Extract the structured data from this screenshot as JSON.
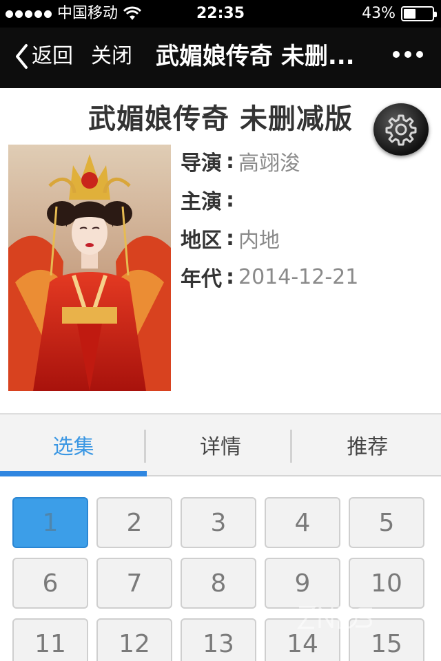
{
  "status_bar": {
    "carrier": "中国移动",
    "time": "22:35",
    "battery_percent": "43%",
    "battery_level": 0.43
  },
  "nav": {
    "back_label": "返回",
    "close_label": "关闭",
    "title": "武媚娘传奇 未删..."
  },
  "detail": {
    "title": "武媚娘传奇 未删减版",
    "info": [
      {
        "key": "导演",
        "value": "高翊浚"
      },
      {
        "key": "主演",
        "value": ""
      },
      {
        "key": "地区",
        "value": "内地"
      },
      {
        "key": "年代",
        "value": "2014-12-21"
      }
    ],
    "separator": ":"
  },
  "tabs": [
    {
      "label": "选集",
      "active": true
    },
    {
      "label": "详情",
      "active": false
    },
    {
      "label": "推荐",
      "active": false
    }
  ],
  "episodes": [
    "1",
    "2",
    "3",
    "4",
    "5",
    "6",
    "7",
    "8",
    "9",
    "10",
    "11",
    "12",
    "13",
    "14",
    "15"
  ],
  "selected_episode": "1",
  "colors": {
    "accent": "#3b97e3",
    "nav_bg": "#0d0d0d",
    "selected_episode_bg": "#3c9ee8"
  },
  "icons": {
    "back": "chevron-left-icon",
    "more": "more-dots-icon",
    "settings": "gear-icon",
    "wifi": "wifi-icon",
    "battery": "battery-icon"
  }
}
